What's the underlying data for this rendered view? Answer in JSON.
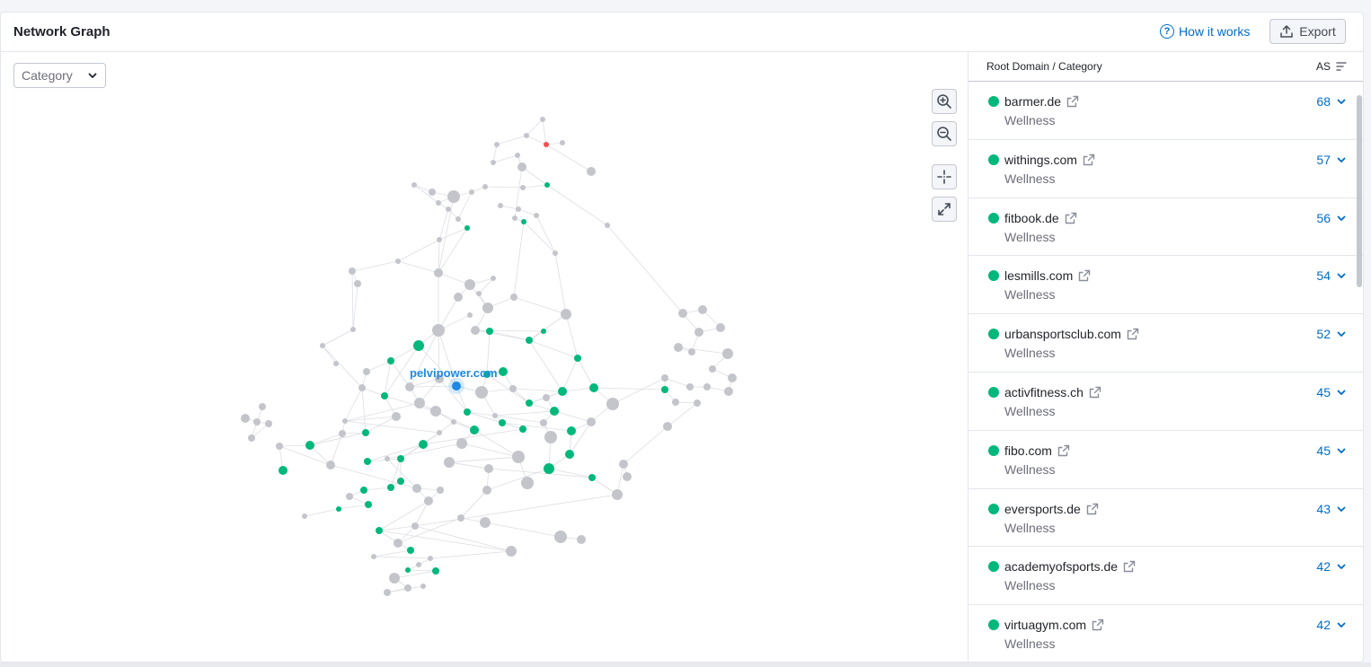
{
  "header": {
    "title": "Network Graph",
    "how_label": "How it works",
    "export_label": "Export"
  },
  "filter": {
    "category_label": "Category"
  },
  "graph": {
    "center_label": "pelvipower.com",
    "colors": {
      "green": "#00b87b",
      "gray": "#c3c5cb",
      "blue": "#1e88e5",
      "red": "#f25050",
      "edge": "#dcdee3",
      "label": "#1e88e5"
    }
  },
  "list": {
    "col_domain": "Root Domain / Category",
    "col_as": "AS",
    "rows": [
      {
        "domain": "barmer.de",
        "category": "Wellness",
        "score": "68"
      },
      {
        "domain": "withings.com",
        "category": "Wellness",
        "score": "57"
      },
      {
        "domain": "fitbook.de",
        "category": "Wellness",
        "score": "56"
      },
      {
        "domain": "lesmills.com",
        "category": "Wellness",
        "score": "54"
      },
      {
        "domain": "urbansportsclub.com",
        "category": "Wellness",
        "score": "52"
      },
      {
        "domain": "activfitness.ch",
        "category": "Wellness",
        "score": "45"
      },
      {
        "domain": "fibo.com",
        "category": "Wellness",
        "score": "45"
      },
      {
        "domain": "eversports.de",
        "category": "Wellness",
        "score": "43"
      },
      {
        "domain": "academyofsports.de",
        "category": "Wellness",
        "score": "42"
      },
      {
        "domain": "virtuagym.com",
        "category": "Wellness",
        "score": "42"
      }
    ]
  }
}
